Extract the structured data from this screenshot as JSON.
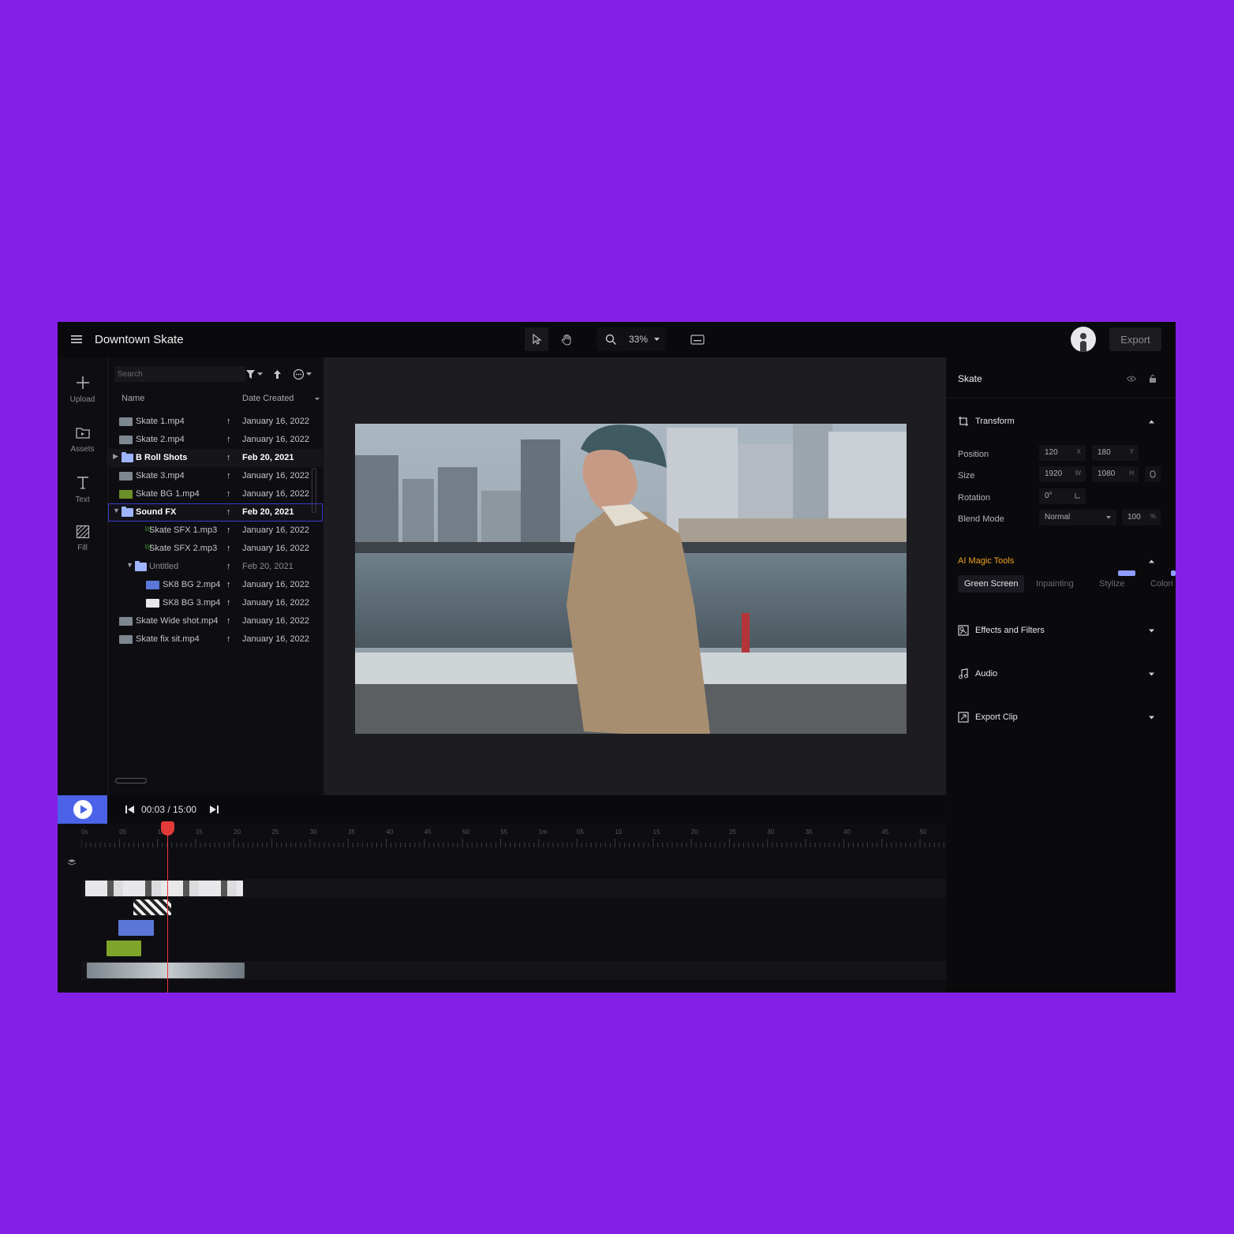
{
  "app": {
    "title": "Downtown Skate",
    "zoom": "33%",
    "export_label": "Export"
  },
  "rail": [
    {
      "label": "Upload",
      "icon": "plus-icon"
    },
    {
      "label": "Assets",
      "icon": "folder-icon"
    },
    {
      "label": "Text",
      "icon": "text-icon"
    },
    {
      "label": "Fill",
      "icon": "fill-icon"
    }
  ],
  "assets": {
    "search_placeholder": "Search",
    "col_name": "Name",
    "col_date": "Date Created",
    "rows": [
      {
        "name": "Skate 1.mp4",
        "date": "January 16, 2022",
        "kind": "video"
      },
      {
        "name": "Skate 2.mp4",
        "date": "January 16, 2022",
        "kind": "video"
      },
      {
        "name": "B Roll Shots",
        "date": "Feb 20, 2021",
        "kind": "folder"
      },
      {
        "name": "Skate 3.mp4",
        "date": "January 16, 2022",
        "kind": "video"
      },
      {
        "name": "Skate BG 1.mp4",
        "date": "January 16, 2022",
        "kind": "video"
      },
      {
        "name": "Sound FX",
        "date": "Feb 20, 2021",
        "kind": "folder"
      },
      {
        "name": "Skate SFX 1.mp3",
        "date": "January 16, 2022",
        "kind": "audio"
      },
      {
        "name": "Skate SFX 2.mp3",
        "date": "January 16, 2022",
        "kind": "audio"
      },
      {
        "name": "Untitled",
        "date": "Feb 20, 2021",
        "kind": "folder"
      },
      {
        "name": "SK8 BG 2.mp4",
        "date": "January 16, 2022",
        "kind": "video"
      },
      {
        "name": "SK8 BG 3.mp4",
        "date": "January 16, 2022",
        "kind": "video"
      },
      {
        "name": "Skate Wide shot.mp4",
        "date": "January 16, 2022",
        "kind": "video"
      },
      {
        "name": "Skate fix sit.mp4",
        "date": "January 16, 2022",
        "kind": "video"
      }
    ]
  },
  "properties": {
    "clip_name": "Skate",
    "transform_label": "Transform",
    "position_label": "Position",
    "position_x": "120",
    "position_x_unit": "X",
    "position_y": "180",
    "position_y_unit": "Y",
    "size_label": "Size",
    "size_w": "1920",
    "size_w_unit": "W",
    "size_h": "1080",
    "size_h_unit": "H",
    "rotation_label": "Rotation",
    "rotation_value": "0°",
    "blend_label": "Blend Mode",
    "blend_value": "Normal",
    "opacity_value": "100",
    "opacity_unit": "%",
    "ai_tools_label": "AI Magic Tools",
    "ai_tabs": [
      "Green Screen",
      "Inpainting",
      "Stylize",
      "Colori"
    ],
    "effects_label": "Effects and Filters",
    "audio_label": "Audio",
    "export_clip_label": "Export Clip"
  },
  "transport": {
    "timecode": "00:03 / 15:00"
  },
  "ruler": [
    "0s",
    "05",
    "10",
    "15",
    "20",
    "25",
    "30",
    "35",
    "40",
    "45",
    "50",
    "55",
    "1m",
    "05",
    "10",
    "15",
    "20",
    "25",
    "30",
    "35",
    "40",
    "45",
    "50"
  ],
  "colors": {
    "background": "#8420e6",
    "accent": "#4a63e8",
    "ai_title": "#f0a020",
    "playhead": "#e43a3a"
  }
}
